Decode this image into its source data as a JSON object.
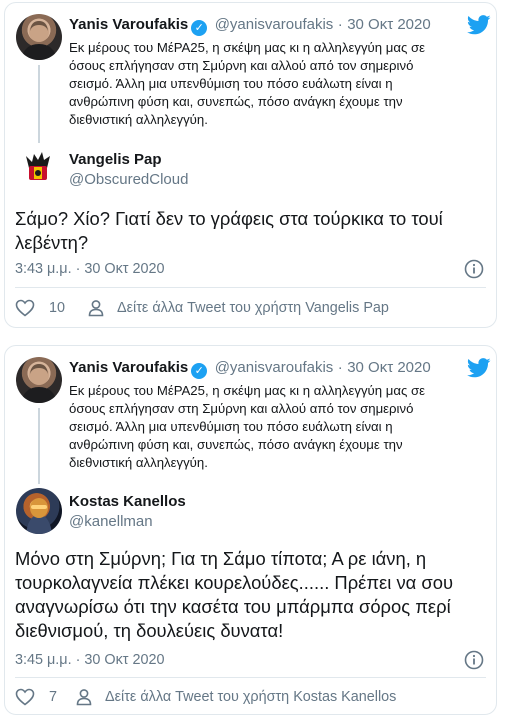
{
  "tweets": [
    {
      "quoted": {
        "author_name": "Yanis Varoufakis",
        "author_handle": "@yanisvaroufakis",
        "separator": "·",
        "date": "30 Οκτ 2020",
        "lines": [
          "Εκ μέρους του ΜέΡΑ25, η σκέψη μας κι η αλληλεγγύη μας σε",
          "όσους επλήγησαν στη Σμύρνη και αλλού από τον σημερινό",
          "σεισμό. Άλλη μια υπενθύμιση του πόσο ευάλωτη είναι η",
          "ανθρώπινη φύση και, συνεπώς, πόσο ανάγκη έχουμε την",
          "διεθνιστική αλληλεγγύη."
        ]
      },
      "reply": {
        "author_name": "Vangelis Pap",
        "author_handle": "@ObscuredCloud",
        "lines": [
          "Σάμο? Χίο? Γιατί δεν το γράφεις στα τούρκικα το τουί",
          "λεβέντη?"
        ],
        "timestamp": "3:43 μ.μ. · 30 Οκτ 2020",
        "likes": "10",
        "profile_link": "Δείτε άλλα Tweet του χρήστη Vangelis Pap"
      }
    },
    {
      "quoted": {
        "author_name": "Yanis Varoufakis",
        "author_handle": "@yanisvaroufakis",
        "separator": "·",
        "date": "30 Οκτ 2020",
        "lines": [
          "Εκ μέρους του ΜέΡΑ25, η σκέψη μας κι η αλληλεγγύη μας σε",
          "όσους επλήγησαν στη Σμύρνη και αλλού από τον σημερινό",
          "σεισμό. Άλλη μια υπενθύμιση του πόσο ευάλωτη είναι η",
          "ανθρώπινη φύση και, συνεπώς, πόσο ανάγκη έχουμε την",
          "διεθνιστική αλληλεγγύη."
        ]
      },
      "reply": {
        "author_name": "Kostas Kanellos",
        "author_handle": "@kanellman",
        "lines": [
          "Μόνο στη Σμύρνη; Για τη Σάμο τίποτα; Α ρε ιάνη, η",
          "τουρκολαγνεία πλέκει κουρελούδες...... Πρέπει να σου",
          "αναγνωρίσω ότι την κασέτα του μπάρμπα σόρος περί",
          "διεθνισμού, τη δουλεύεις δυνατα!"
        ],
        "timestamp": "3:45 μ.μ. · 30 Οκτ 2020",
        "likes": "7",
        "profile_link": "Δείτε άλλα Tweet του χρήστη Kostas Kanellos"
      }
    }
  ],
  "colors": {
    "twitter_blue": "#1da1f2",
    "secondary_text": "#657786",
    "border": "#e1e8ed"
  },
  "icons": [
    "twitter-bird-icon",
    "verified-badge-icon",
    "info-icon",
    "heart-icon",
    "person-icon"
  ]
}
